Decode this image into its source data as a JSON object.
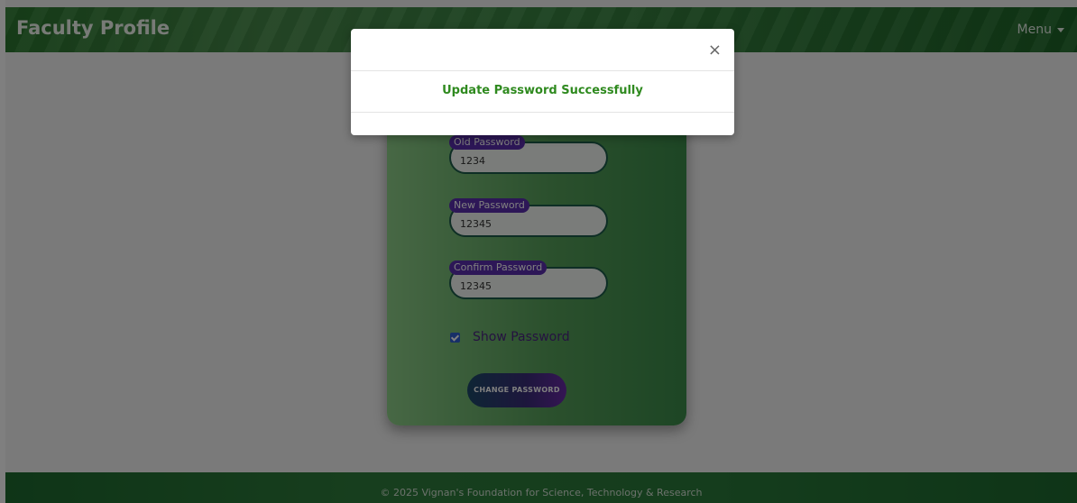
{
  "header": {
    "title": "Faculty Profile",
    "menu_label": "Menu"
  },
  "form": {
    "old_password": {
      "label": "Old Password",
      "value": "1234"
    },
    "new_password": {
      "label": "New Password",
      "value": "12345"
    },
    "confirm_password": {
      "label": "Confirm Password",
      "value": "12345"
    },
    "show_password": {
      "label": "Show Password",
      "checked": true
    },
    "submit_label": "CHANGE PASSWORD"
  },
  "modal": {
    "close_label": "×",
    "message": "Update Password Successfully"
  },
  "footer": {
    "text": "© 2025 Vignan's Foundation for Science, Technology & Research"
  },
  "colors": {
    "header_green": "#2e7d32",
    "label_purple": "#5a2fae",
    "success_green": "#2f8a1f"
  }
}
